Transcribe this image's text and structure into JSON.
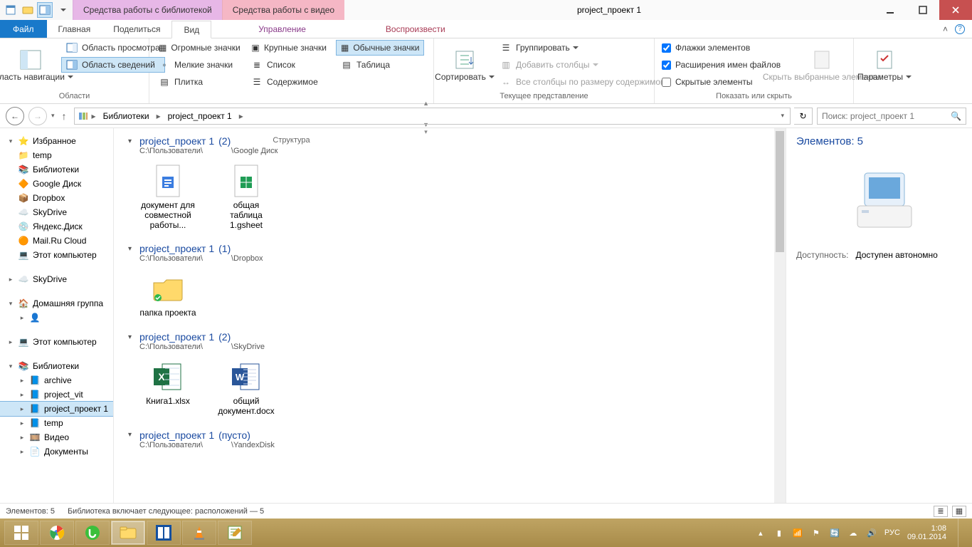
{
  "window": {
    "title": "project_проект 1",
    "context_tabs": {
      "library": "Средства работы с библиотекой",
      "video": "Средства работы с видео"
    }
  },
  "tabs": {
    "file": "Файл",
    "home": "Главная",
    "share": "Поделиться",
    "view": "Вид",
    "manage": "Управление",
    "play": "Воспроизвести"
  },
  "ribbon": {
    "panes": {
      "nav_pane": "Область навигации",
      "preview": "Область просмотра",
      "details": "Область сведений",
      "group": "Области"
    },
    "layout": {
      "huge": "Огромные значки",
      "large": "Крупные значки",
      "medium": "Обычные значки",
      "small": "Мелкие значки",
      "list": "Список",
      "details": "Таблица",
      "tiles": "Плитка",
      "content": "Содержимое",
      "group": "Структура"
    },
    "current": {
      "sort": "Сортировать",
      "group_by": "Группировать",
      "add_cols": "Добавить столбцы",
      "size_cols": "Все столбцы по размеру содержимого",
      "group": "Текущее представление"
    },
    "showhide": {
      "checkboxes": "Флажки элементов",
      "extensions": "Расширения имен файлов",
      "hidden": "Скрытые элементы",
      "hide_selected": "Скрыть выбранные элементы",
      "group": "Показать или скрыть"
    },
    "options": {
      "label": "Параметры"
    }
  },
  "address": {
    "crumbs": [
      "Библиотеки",
      "project_проект 1"
    ],
    "search_placeholder": "Поиск: project_проект 1"
  },
  "tree": {
    "favorites": {
      "title": "Избранное",
      "items": [
        "temp",
        "Библиотеки",
        "Google Диск",
        "Dropbox",
        "SkyDrive",
        "Яндекс.Диск",
        "Mail.Ru Cloud",
        "Этот компьютер"
      ]
    },
    "skydrive": "SkyDrive",
    "homegroup": "Домашняя группа",
    "thispc": "Этот компьютер",
    "libraries": {
      "title": "Библиотеки",
      "items": [
        "archive",
        "project_vit",
        "project_проект 1",
        "temp",
        "Видео",
        "Документы"
      ]
    }
  },
  "groups": [
    {
      "title": "project_проект 1",
      "count": "(2)",
      "path_a": "C:\\Пользователи\\",
      "path_b": "\\Google Диск",
      "items": [
        {
          "name": "документ для совместной работы...",
          "icon": "gdoc"
        },
        {
          "name": "общая таблица 1.gsheet",
          "icon": "gsheet"
        }
      ]
    },
    {
      "title": "project_проект 1",
      "count": "(1)",
      "path_a": "C:\\Пользователи\\",
      "path_b": "\\Dropbox",
      "items": [
        {
          "name": "папка проекта",
          "icon": "folder"
        }
      ]
    },
    {
      "title": "project_проект 1",
      "count": "(2)",
      "path_a": "C:\\Пользователи\\",
      "path_b": "\\SkyDrive",
      "items": [
        {
          "name": "Книга1.xlsx",
          "icon": "xlsx"
        },
        {
          "name": "общий документ.docx",
          "icon": "docx"
        }
      ]
    },
    {
      "title": "project_проект 1",
      "count": "(пусто)",
      "path_a": "C:\\Пользователи\\",
      "path_b": "\\YandexDisk",
      "items": []
    }
  ],
  "details_pane": {
    "header": "Элементов: 5",
    "avail_key": "Доступность:",
    "avail_val": "Доступен автономно"
  },
  "status": {
    "left1": "Элементов: 5",
    "left2": "Библиотека включает следующее: расположений — 5"
  },
  "tray": {
    "lang": "РУС",
    "time": "1:08",
    "date": "09.01.2014"
  }
}
